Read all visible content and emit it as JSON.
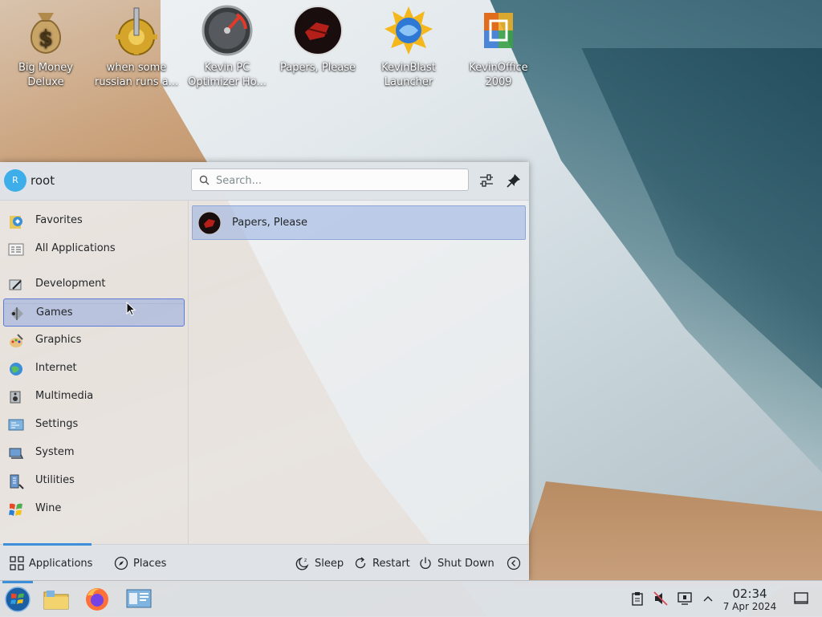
{
  "desktop": {
    "icons": [
      {
        "label": "Big Money\nDeluxe",
        "icon": "money-bag-icon"
      },
      {
        "label": "when some\nrussian runs a...",
        "icon": "gear-joystick-icon"
      },
      {
        "label": "Kevin PC\nOptimizer Ho...",
        "icon": "speedometer-icon"
      },
      {
        "label": "Papers, Please",
        "icon": "papers-please-icon"
      },
      {
        "label": "KevinBlast\nLauncher",
        "icon": "kevinblast-icon"
      },
      {
        "label": "KevinOffice\n2009",
        "icon": "office-icon"
      }
    ]
  },
  "launcher": {
    "user": {
      "avatar_initial": "R",
      "name": "root"
    },
    "search": {
      "placeholder": "Search..."
    },
    "categories": [
      {
        "label": "Favorites",
        "icon": "favorites-icon"
      },
      {
        "label": "All Applications",
        "icon": "all-apps-icon"
      },
      {
        "label": "Development",
        "icon": "development-icon"
      },
      {
        "label": "Games",
        "icon": "games-icon",
        "selected": true
      },
      {
        "label": "Graphics",
        "icon": "graphics-icon"
      },
      {
        "label": "Internet",
        "icon": "internet-icon"
      },
      {
        "label": "Multimedia",
        "icon": "multimedia-icon"
      },
      {
        "label": "Settings",
        "icon": "settings-icon"
      },
      {
        "label": "System",
        "icon": "system-icon"
      },
      {
        "label": "Utilities",
        "icon": "utilities-icon"
      },
      {
        "label": "Wine",
        "icon": "wine-icon"
      }
    ],
    "results": [
      {
        "label": "Papers, Please",
        "icon": "papers-please-icon"
      }
    ],
    "footer": {
      "tabs": [
        {
          "label": "Applications",
          "icon": "grid-icon",
          "active": true
        },
        {
          "label": "Places",
          "icon": "compass-icon"
        }
      ],
      "actions": [
        {
          "label": "Sleep",
          "icon": "sleep-icon"
        },
        {
          "label": "Restart",
          "icon": "restart-icon"
        },
        {
          "label": "Shut Down",
          "icon": "power-icon"
        }
      ]
    }
  },
  "taskbar": {
    "apps": [
      {
        "name": "start-menu",
        "icon": "windows-orb-icon"
      },
      {
        "name": "file-manager",
        "icon": "folder-icon"
      },
      {
        "name": "firefox",
        "icon": "firefox-icon"
      },
      {
        "name": "system-settings",
        "icon": "settings-app-icon"
      }
    ],
    "tray": [
      "clipboard-icon",
      "volume-muted-icon",
      "display-icon",
      "chevron-up-icon"
    ],
    "clock": {
      "time": "02:34",
      "date": "7 Apr 2024"
    }
  },
  "colors": {
    "accent": "#3daee9",
    "selection": "#93aadc",
    "selection_border": "#5b7bd5"
  }
}
